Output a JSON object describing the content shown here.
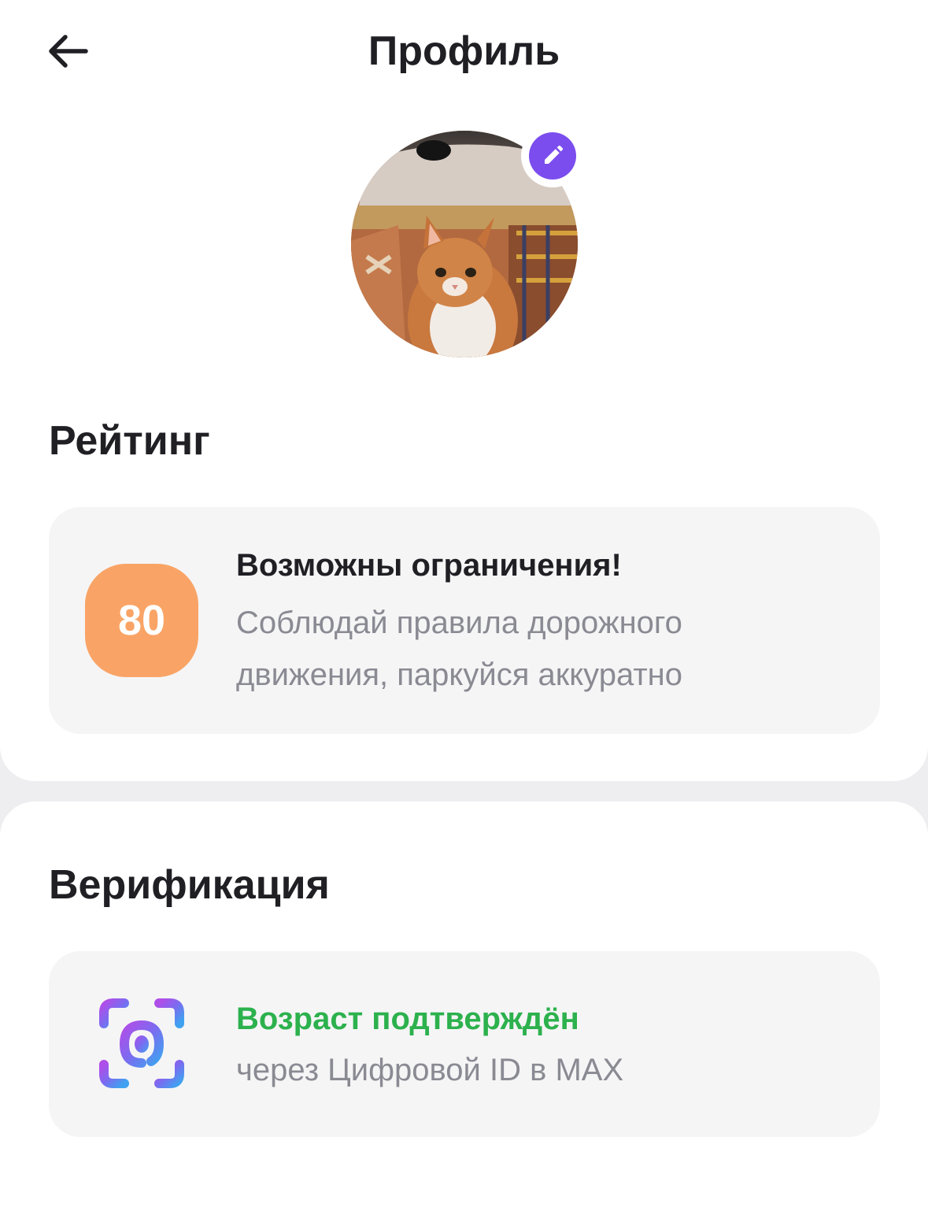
{
  "header": {
    "title": "Профиль",
    "back_icon": "arrow-left-icon"
  },
  "profile": {
    "avatar": "cat-avatar-photo",
    "edit_icon": "pencil-icon"
  },
  "rating": {
    "section_title": "Рейтинг",
    "score": "80",
    "score_color": "#f9a466",
    "headline": "Возможны ограничения!",
    "description": "Соблюдай правила дорожного движения, паркуйся аккуратно"
  },
  "verification": {
    "section_title": "Верификация",
    "status": "Возраст подтверждён",
    "status_color": "#2cb14d",
    "method": "через Цифровой ID в MAX",
    "icon": "face-scan-icon"
  },
  "colors": {
    "accent": "#7b4dee",
    "card_bg": "#f5f5f6",
    "page_bg": "#eeeef0"
  }
}
